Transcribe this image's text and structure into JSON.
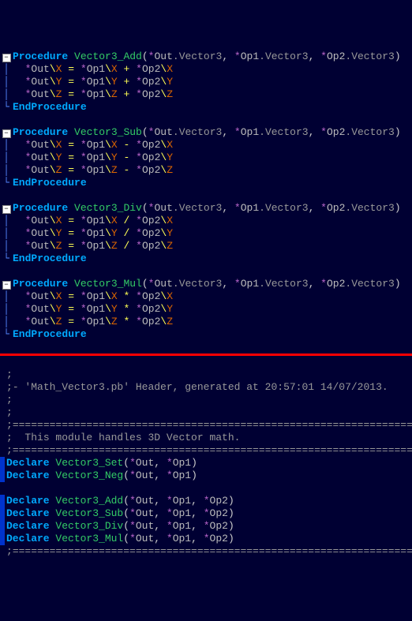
{
  "upper": {
    "procedures": [
      {
        "name": "Vector3_Add",
        "op": "+"
      },
      {
        "name": "Vector3_Sub",
        "op": "-"
      },
      {
        "name": "Vector3_Div",
        "op": "/"
      },
      {
        "name": "Vector3_Mul",
        "op": "*"
      }
    ],
    "proc_keyword": "Procedure",
    "endproc_keyword": "EndProcedure",
    "params": {
      "out": "Out",
      "op1": "Op1",
      "op2": "Op2",
      "type": "Vector3"
    },
    "fields": [
      "X",
      "Y",
      "Z"
    ]
  },
  "lower": {
    "header_comment_1": "- 'Math_Vector3.pb' Header, generated at 20:57:01 14/07/2013.",
    "header_comment_2": "  This module handles 3D Vector math.",
    "sep": "==========================================================================",
    "declare_keyword": "Declare",
    "declares_unary": [
      {
        "name": "Vector3_Set"
      },
      {
        "name": "Vector3_Neg"
      }
    ],
    "declares_binary": [
      {
        "name": "Vector3_Add"
      },
      {
        "name": "Vector3_Sub"
      },
      {
        "name": "Vector3_Div"
      },
      {
        "name": "Vector3_Mul"
      }
    ],
    "params": {
      "out": "Out",
      "op1": "Op1",
      "op2": "Op2"
    }
  }
}
